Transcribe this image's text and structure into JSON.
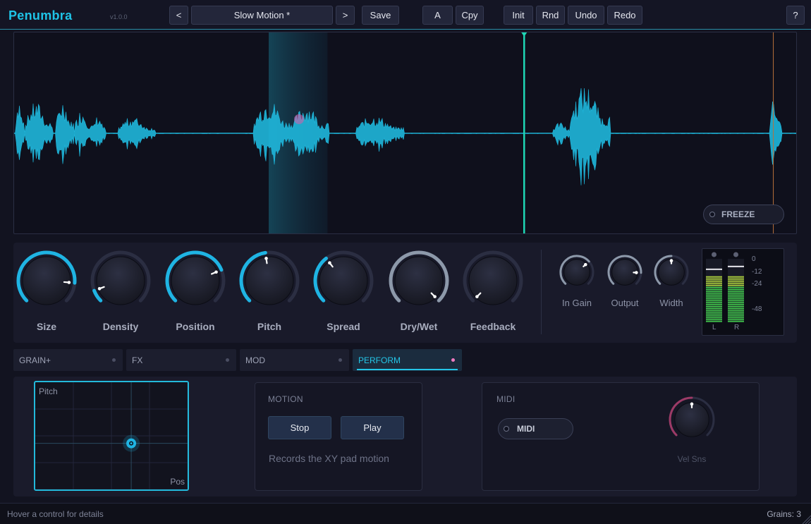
{
  "app": {
    "name": "Penumbra",
    "version": "v1.0.0"
  },
  "header": {
    "prev_label": "<",
    "next_label": ">",
    "preset_name": "Slow Motion *",
    "save_label": "Save",
    "a_label": "A",
    "copy_label": "Cpy",
    "init_label": "Init",
    "random_label": "Rnd",
    "undo_label": "Undo",
    "redo_label": "Redo",
    "help_label": "?"
  },
  "waveform": {
    "freeze_label": "FREEZE",
    "freeze_on": false,
    "playhead_position": 0.651,
    "end_marker_position": 0.969,
    "selection_start": 0.325,
    "selection_end": 0.4,
    "color": "#1fb7dc",
    "playhead_color": "#1fd6b4"
  },
  "knobs": [
    {
      "label": "Size",
      "value": 0.85
    },
    {
      "label": "Density",
      "value": 0.09
    },
    {
      "label": "Position",
      "value": 0.75
    },
    {
      "label": "Pitch",
      "value": 0.47
    },
    {
      "label": "Spread",
      "value": 0.36
    },
    {
      "label": "Dry/Wet",
      "value": 1.0
    },
    {
      "label": "Feedback",
      "value": 0.0
    }
  ],
  "small_knobs": [
    {
      "label": "In Gain",
      "value": 0.68
    },
    {
      "label": "Output",
      "value": 0.84
    },
    {
      "label": "Width",
      "value": 0.5
    }
  ],
  "meter": {
    "ticks": [
      "0",
      "-12",
      "-24",
      "-48"
    ],
    "channels": [
      "L",
      "R"
    ],
    "level_left": 0.82,
    "level_right": 0.82
  },
  "tabs": [
    {
      "label": "GRAIN+",
      "active": false
    },
    {
      "label": "FX",
      "active": false
    },
    {
      "label": "MOD",
      "active": false
    },
    {
      "label": "PERFORM",
      "active": true
    }
  ],
  "xypad": {
    "y_label": "Pitch",
    "x_label": "Pos",
    "x_value": 0.63,
    "y_value": 0.43
  },
  "motion": {
    "title": "MOTION",
    "stop_label": "Stop",
    "play_label": "Play",
    "hint": "Records the XY pad motion"
  },
  "midi": {
    "title": "MIDI",
    "toggle_label": "MIDI",
    "toggle_on": false,
    "vel_label": "Vel Sns",
    "vel_value": 0.5
  },
  "status": {
    "hint": "Hover a control for details",
    "grains": "Grains: 3"
  }
}
